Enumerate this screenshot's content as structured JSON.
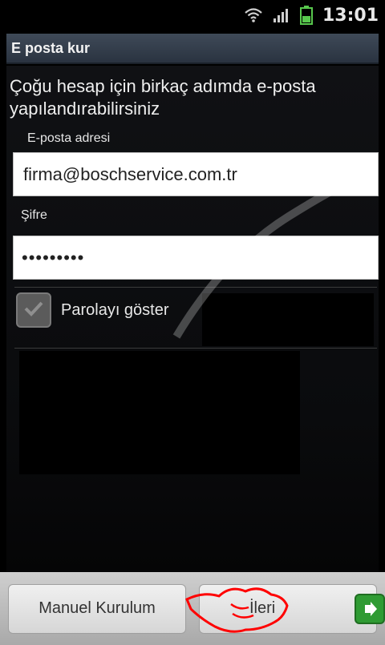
{
  "status": {
    "time": "13:01",
    "icons": [
      "wifi-icon",
      "signal-icon",
      "battery-icon"
    ]
  },
  "header": {
    "title": "E posta kur"
  },
  "main": {
    "intro_text": "Çoğu hesap için birkaç adımda e-posta yapılandırabilirsiniz",
    "email": {
      "label": "E-posta adresi",
      "value": "firma@boschservice.com.tr"
    },
    "password": {
      "label": "Şifre",
      "value": "•••••••••"
    },
    "show_password": {
      "label": "Parolayı göster",
      "checked": true
    }
  },
  "footer": {
    "manual_setup_label": "Manuel Kurulum",
    "next_label": "İleri",
    "next_icon": "arrow-right-icon"
  },
  "colors": {
    "accent_green": "#2f9b33",
    "title_bar": "#3a4350"
  }
}
